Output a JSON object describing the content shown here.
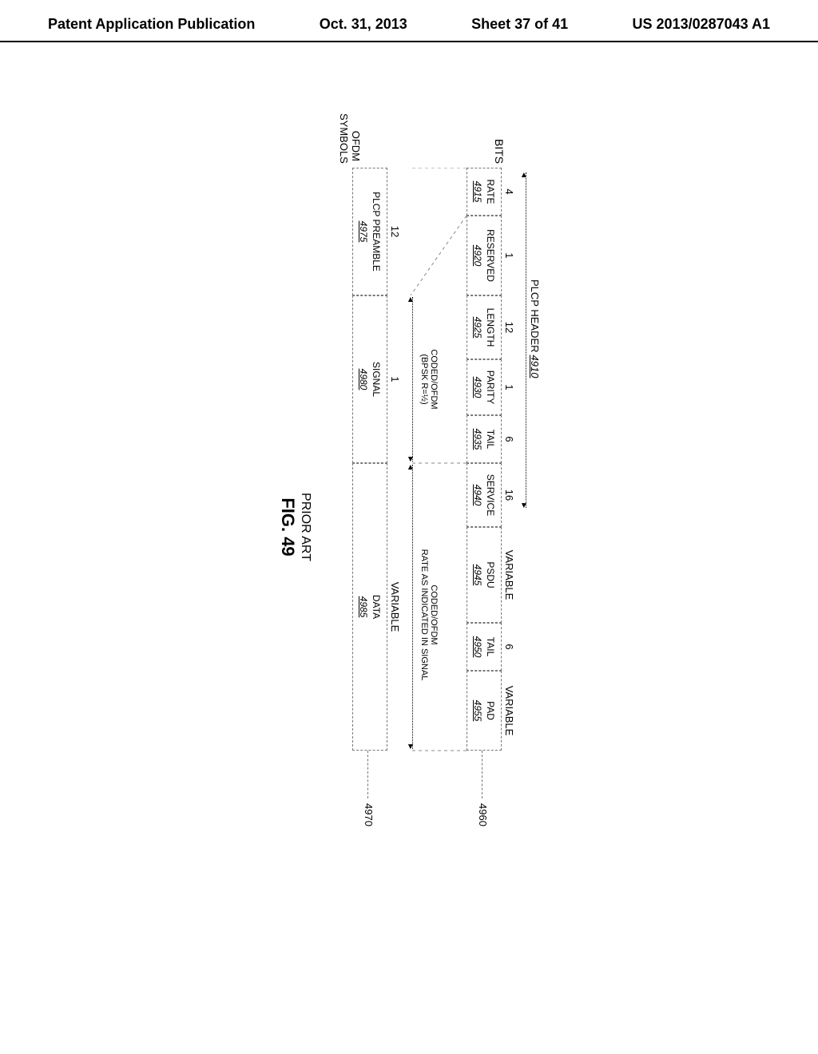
{
  "header": {
    "left": "Patent Application Publication",
    "date": "Oct. 31, 2013",
    "sheet": "Sheet 37 of 41",
    "pubno": "US 2013/0287043 A1"
  },
  "bits_label": "BITS",
  "ofdm_label": "OFDM SYMBOLS",
  "plcp_header": {
    "label": "PLCP HEADER",
    "ref": "4910"
  },
  "fields": {
    "rate": {
      "bits": "4",
      "name": "RATE",
      "ref": "4915"
    },
    "reserved": {
      "bits": "1",
      "name": "RESERVED",
      "ref": "4920"
    },
    "length": {
      "bits": "12",
      "name": "LENGTH",
      "ref": "4925"
    },
    "parity": {
      "bits": "1",
      "name": "PARITY",
      "ref": "4930"
    },
    "tail1": {
      "bits": "6",
      "name": "TAIL",
      "ref": "4935"
    },
    "service": {
      "bits": "16",
      "name": "SERVICE",
      "ref": "4940"
    },
    "psdu": {
      "bits": "VARIABLE",
      "name": "PSDU",
      "ref": "4945"
    },
    "tail2": {
      "bits": "6",
      "name": "TAIL",
      "ref": "4950"
    },
    "pad": {
      "bits": "VARIABLE",
      "name": "PAD",
      "ref": "4955"
    }
  },
  "leads": {
    "upper": "4960",
    "lower": "4970"
  },
  "coding": {
    "signal": "CODED/OFDM\n(BPSK R=½)",
    "data": "CODED/OFDM\nRATE AS INDICATED IN SIGNAL"
  },
  "symbols": {
    "preamble": {
      "count": "12",
      "name": "PLCP PREAMBLE",
      "ref": "4975"
    },
    "signal": {
      "count": "1",
      "name": "SIGNAL",
      "ref": "4980"
    },
    "data": {
      "count": "VARIABLE",
      "name": "DATA",
      "ref": "4985"
    }
  },
  "caption": {
    "prior": "PRIOR ART",
    "fig": "FIG. 49"
  }
}
